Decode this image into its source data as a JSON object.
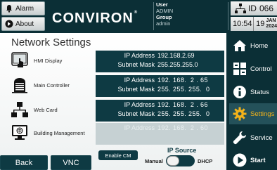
{
  "topbar": {
    "alarm_label": "Alarm",
    "about_label": "About",
    "logo": "CONVIRON",
    "logo_mark": "®",
    "user_key": "User",
    "user_value": "ADMIN",
    "group_key": "Group",
    "group_value": "admin",
    "id_label": "ID",
    "id_value": "066",
    "time": "10:54",
    "day": "19",
    "month": "JAN",
    "year": "2024"
  },
  "page": {
    "title": "Network Settings"
  },
  "rows": [
    {
      "label": "HMI Display",
      "k1": "IP Address",
      "v1": "192.168.2.69",
      "k2": "Subnet Mask",
      "v2": "255.255.255.0"
    },
    {
      "label": "Main Controller",
      "k1": "IP Address",
      "v1": "192. 168.  2 . 65",
      "k2": "Subnet Mask",
      "v2": "255. 255. 255.  0"
    },
    {
      "label": "Web Card",
      "k1": "IP Address",
      "v1": "192. 168.  2 . 66",
      "k2": "Subnet Mask",
      "v2": "255. 255. 255.  0"
    },
    {
      "label": "Building Management",
      "k1": "IP Address",
      "v1": "192. 168.  2 . 60",
      "k2": "",
      "v2": ""
    }
  ],
  "buttons": {
    "back": "Back",
    "vnc": "VNC",
    "enable_cm": "Enable CM"
  },
  "ip_source": {
    "title": "IP Source",
    "manual": "Manual",
    "dhcp": "DHCP",
    "selected": "Manual"
  },
  "nav": [
    {
      "label": "Home",
      "icon": "home-icon"
    },
    {
      "label": "Control",
      "icon": "control-icon"
    },
    {
      "label": "Status",
      "icon": "info-icon"
    },
    {
      "label": "Settings",
      "icon": "gear-icon",
      "active": true
    },
    {
      "label": "Service",
      "icon": "wrench-icon"
    },
    {
      "label": "Start",
      "icon": "play-icon"
    }
  ],
  "colors": {
    "dark_teal": "#0b2f36",
    "panel_teal": "#0e3a43",
    "active_orange": "#f2b21a"
  }
}
